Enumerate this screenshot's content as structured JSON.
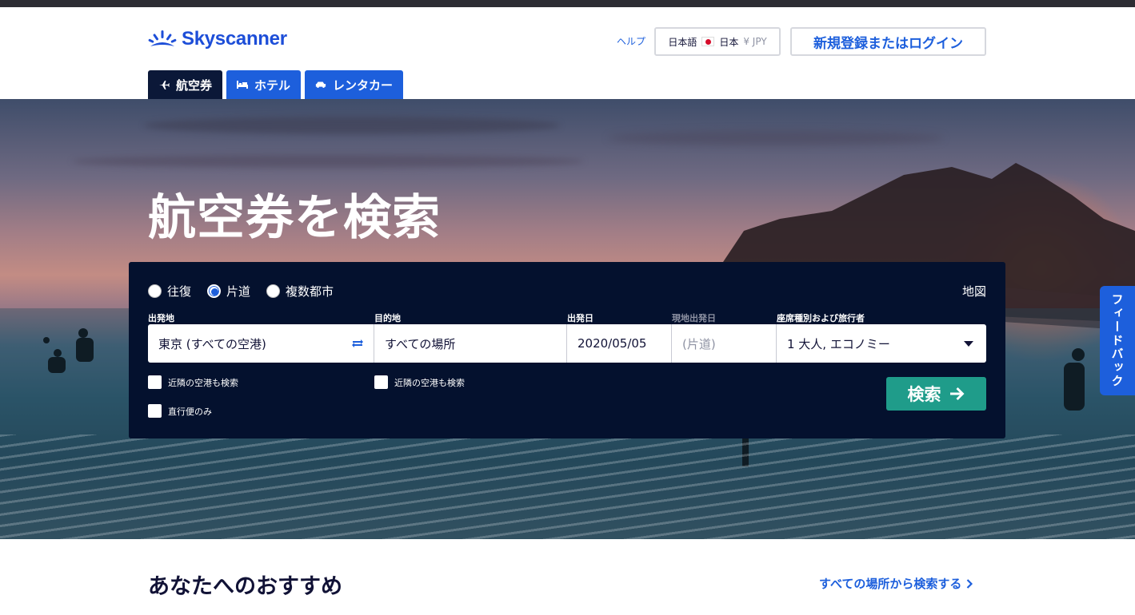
{
  "header": {
    "logo_text": "Skyscanner",
    "help_label": "ヘルプ",
    "locale": {
      "language": "日本語",
      "country": "日本",
      "currency": "¥ JPY"
    },
    "login_label": "新規登録またはログイン"
  },
  "tabs": [
    {
      "label": "航空券",
      "icon": "plane-icon",
      "active": true
    },
    {
      "label": "ホテル",
      "icon": "bed-icon",
      "active": false
    },
    {
      "label": "レンタカー",
      "icon": "car-icon",
      "active": false
    }
  ],
  "hero": {
    "title": "航空券を検索"
  },
  "search": {
    "trip_types": [
      {
        "label": "往復",
        "selected": false
      },
      {
        "label": "片道",
        "selected": true
      },
      {
        "label": "複数都市",
        "selected": false
      }
    ],
    "map_label": "地図",
    "origin": {
      "label": "出発地",
      "value": "東京 (すべての空港)"
    },
    "destination": {
      "label": "目的地",
      "value": "すべての場所"
    },
    "depart": {
      "label": "出発日",
      "value": "2020/05/05"
    },
    "return": {
      "label": "現地出発日",
      "value": "(片道)"
    },
    "cabin": {
      "label": "座席種別および旅行者",
      "value": "1 大人, エコノミー"
    },
    "nearby_origin_label": "近隣の空港も検索",
    "nearby_destination_label": "近隣の空港も検索",
    "direct_only_label": "直行便のみ",
    "search_button_label": "検索"
  },
  "feedback_label": "フィードバック",
  "recommendations": {
    "title": "あなたへのおすすめ",
    "link_label": "すべての場所から検索する"
  },
  "colors": {
    "brand_blue": "#1d5fdc",
    "panel_navy": "#04112e",
    "search_green": "#1f9c8a"
  }
}
